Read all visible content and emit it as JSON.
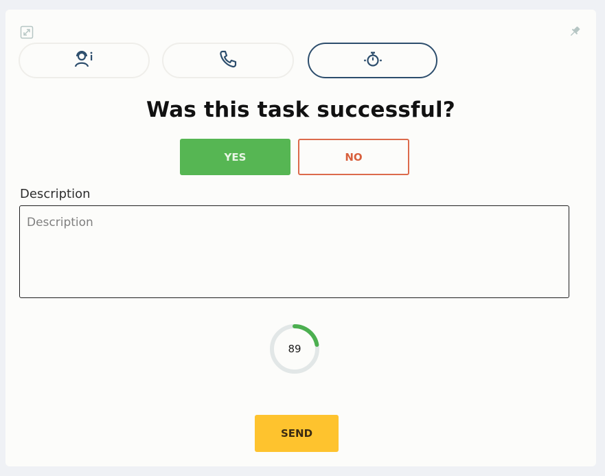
{
  "icons": {
    "top_left": "collapse-icon",
    "top_right": "pin-icon",
    "tab1": "agent-info-icon",
    "tab2": "phone-icon",
    "tab3": "stopwatch-icon"
  },
  "tabs": {
    "active_index": 3
  },
  "question": {
    "title": "Was this task successful?",
    "yes_label": "YES",
    "no_label": "NO"
  },
  "description": {
    "label": "Description",
    "placeholder": "Description",
    "value": ""
  },
  "timer": {
    "value": "89",
    "progress_fraction": 0.22
  },
  "actions": {
    "send_label": "SEND"
  },
  "colors": {
    "yes": "#56b653",
    "no": "#dc6a4b",
    "send": "#fec32e",
    "accent": "#2c4d6c",
    "timer_track": "#e2e7e7",
    "timer_fill": "#4caf50"
  }
}
